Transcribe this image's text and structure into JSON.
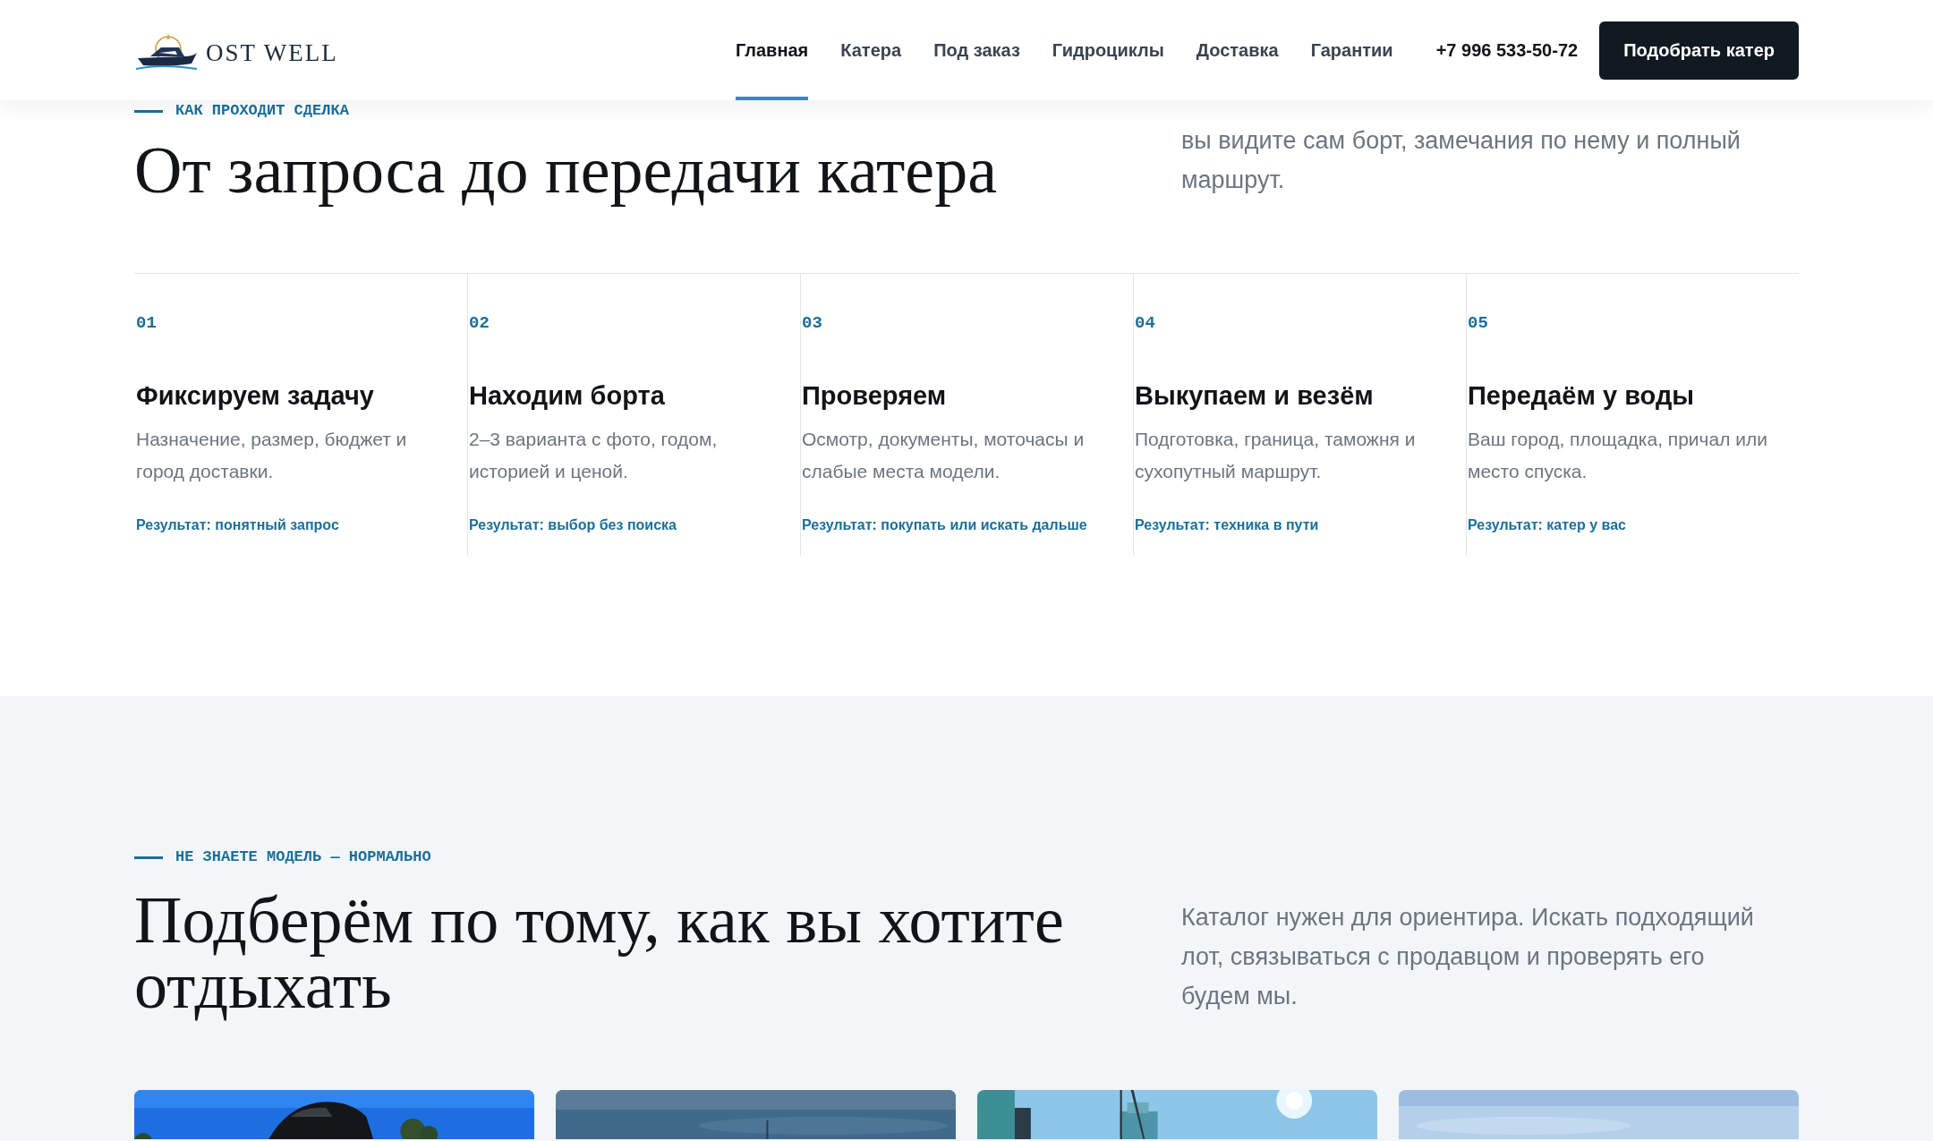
{
  "header": {
    "logo": {
      "text": "OST WELL"
    },
    "nav": [
      {
        "label": "Главная",
        "selected": true
      },
      {
        "label": "Катера",
        "selected": false
      },
      {
        "label": "Под заказ",
        "selected": false
      },
      {
        "label": "Гидроциклы",
        "selected": false
      },
      {
        "label": "Доставка",
        "selected": false
      },
      {
        "label": "Гарантии",
        "selected": false
      }
    ],
    "phone": "+7 996 533-50-72",
    "cta": "Подобрать катер"
  },
  "process": {
    "eyebrow": "КАК ПРОХОДИТ СДЕЛКА",
    "title": "От запроса до передачи катера",
    "lead": "вы видите сам борт, замечания по нему и полный маршрут.",
    "steps": [
      {
        "number": "01",
        "title": "Фиксируем задачу",
        "text": "Назначение, размер, бюджет и город доставки.",
        "result": "Результат: понятный запрос"
      },
      {
        "number": "02",
        "title": "Находим борта",
        "text": "2–3 варианта с фото, годом, историей и ценой.",
        "result": "Результат: выбор без поиска"
      },
      {
        "number": "03",
        "title": "Проверяем",
        "text": "Осмотр, документы, моточасы и слабые места модели.",
        "result": "Результат: покупать или искать дальше"
      },
      {
        "number": "04",
        "title": "Выкупаем и везём",
        "text": "Подготовка, граница, таможня и сухопутный маршрут.",
        "result": "Результат: техника в пути"
      },
      {
        "number": "05",
        "title": "Передаём у воды",
        "text": "Ваш город, площадка, причал или место спуска.",
        "result": "Результат: катер у вас"
      }
    ]
  },
  "selection": {
    "eyebrow": "НЕ ЗНАЕТЕ МОДЕЛЬ — НОРМАЛЬНО",
    "title": "Подберём по тому, как вы хотите отдыхать",
    "lead": "Каталог нужен для ориентира. Искать подходящий лот, связываться с продавцом и проверять его будем мы."
  }
}
